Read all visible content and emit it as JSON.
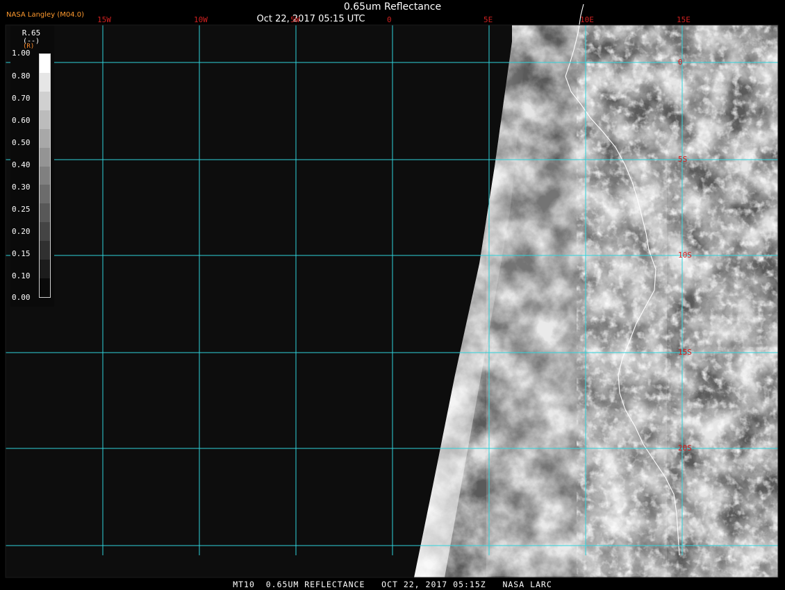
{
  "header": {
    "title": "0.65um Reflectance",
    "timestamp": "Oct 22, 2017 05:15 UTC",
    "org": "NASA Langley (M04.0)"
  },
  "footer": {
    "caption": "MT10  0.65UM REFLECTANCE   OCT 22, 2017 05:15Z   NASA LARC"
  },
  "legend": {
    "title": "R.65",
    "unit": "(--)",
    "label_mark": "(R)",
    "labels": [
      "1.00",
      "0.80",
      "0.70",
      "0.60",
      "0.50",
      "0.40",
      "0.30",
      "0.25",
      "0.20",
      "0.15",
      "0.10",
      "0.00"
    ],
    "colors": [
      "#ffffff",
      "#e6e6e6",
      "#d0d0d0",
      "#bcbcbc",
      "#a8a8a8",
      "#949494",
      "#808080",
      "#6c6c6c",
      "#585858",
      "#444444",
      "#303030",
      "#1c1c1c",
      "#0a0a0a"
    ]
  },
  "map": {
    "lon_labels": [
      "15W",
      "10W",
      "5W",
      "0",
      "5E",
      "10E",
      "15E"
    ],
    "lat_labels": [
      "0",
      "5S",
      "10S",
      "15S",
      "20S"
    ],
    "grid_color": "#2fd4dc",
    "label_color": "#d02020",
    "coast_color": "#ffffff",
    "background": "#0d0d0d"
  }
}
